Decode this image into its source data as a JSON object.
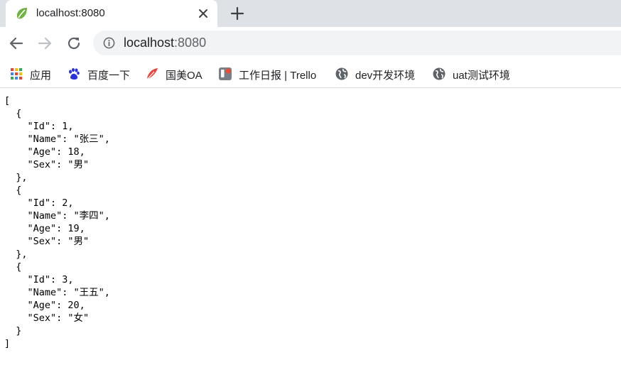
{
  "colors": {
    "tabstrip_bg": "#dee1e6",
    "omnibox_bg": "#f1f3f4",
    "spring_green": "#6db33f"
  },
  "tab": {
    "title": "localhost:8080",
    "favicon": "spring-leaf-icon",
    "close_icon": "close-icon"
  },
  "new_tab": {
    "icon": "plus-icon"
  },
  "toolbar": {
    "back_icon": "back-arrow-icon",
    "forward_icon": "forward-arrow-icon",
    "reload_icon": "reload-icon",
    "url_host": "localhost",
    "url_port": ":8080"
  },
  "bookmarks": [
    {
      "label": "应用",
      "icon": "apps-grid-icon"
    },
    {
      "label": "百度一下",
      "icon": "baidu-paw-icon"
    },
    {
      "label": "国美OA",
      "icon": "feather-icon"
    },
    {
      "label": "工作日报 | Trello",
      "icon": "trello-icon"
    },
    {
      "label": "dev开发环境",
      "icon": "globe-icon"
    },
    {
      "label": "uat测试环境",
      "icon": "globe-icon"
    }
  ],
  "json_lines": [
    "[",
    "  {",
    "    \"Id\": 1,",
    "    \"Name\": \"张三\",",
    "    \"Age\": 18,",
    "    \"Sex\": \"男\"",
    "  },",
    "  {",
    "    \"Id\": 2,",
    "    \"Name\": \"李四\",",
    "    \"Age\": 19,",
    "    \"Sex\": \"男\"",
    "  },",
    "  {",
    "    \"Id\": 3,",
    "    \"Name\": \"王五\",",
    "    \"Age\": 20,",
    "    \"Sex\": \"女\"",
    "  }",
    "]"
  ]
}
